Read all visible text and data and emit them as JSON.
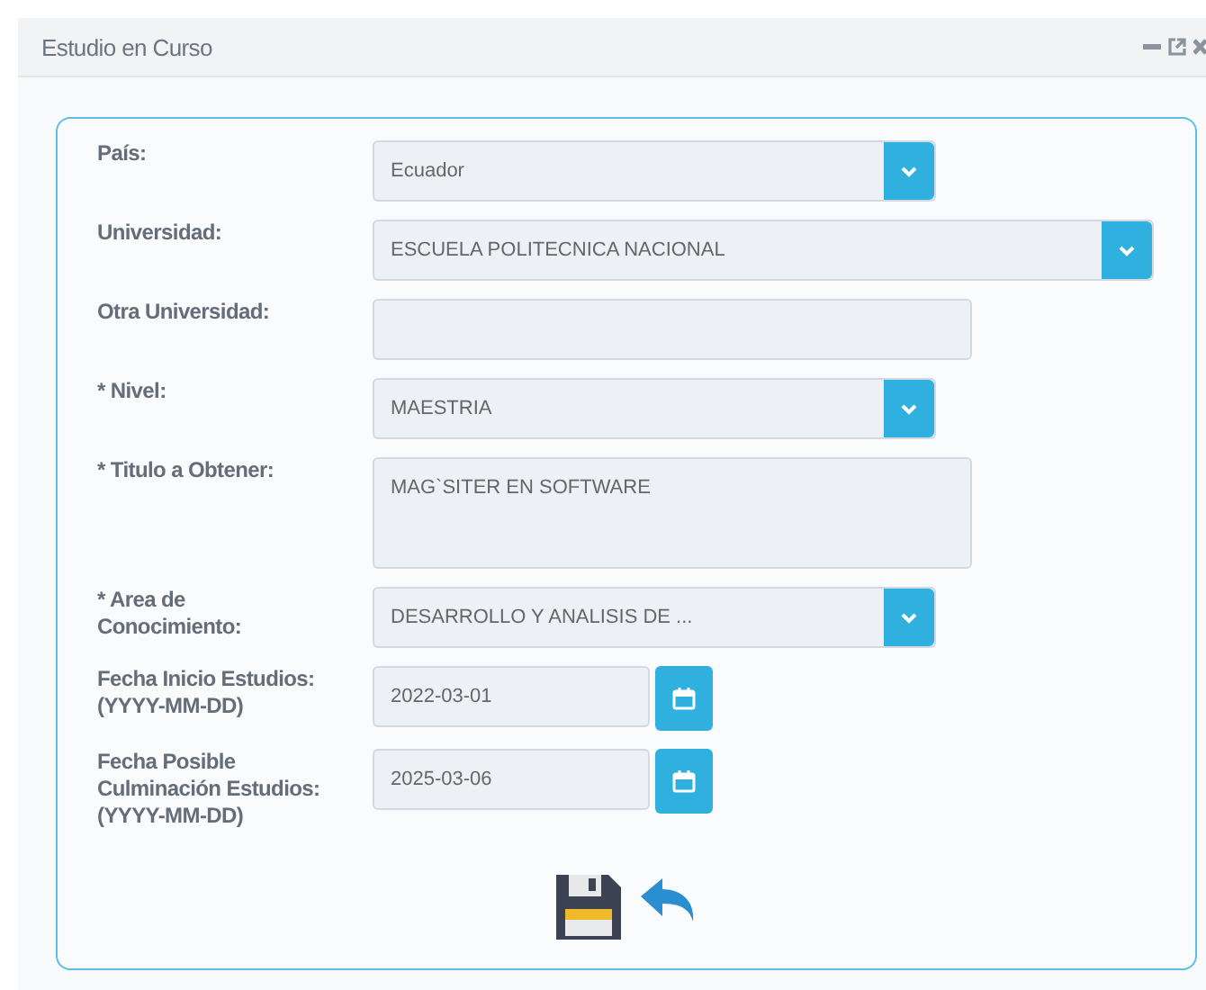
{
  "window": {
    "title": "Estudio en Curso"
  },
  "fields": [
    {
      "label": [
        "País:"
      ],
      "kind": "select",
      "value": "Ecuador"
    },
    {
      "label": [
        "Universidad:"
      ],
      "kind": "wide-select",
      "value": "ESCUELA POLITECNICA NACIONAL"
    },
    {
      "label": [
        "Otra Universidad:"
      ],
      "kind": "text"
    },
    {
      "label": [
        "* Nivel:"
      ],
      "kind": "select",
      "value": "MAESTRIA"
    },
    {
      "label": [
        "* Titulo a Obtener:"
      ],
      "kind": "textarea",
      "value": "MAG`SITER EN SOFTWARE"
    },
    {
      "label": [
        "* Area de",
        "Conocimiento:"
      ],
      "kind": "select",
      "value": "DESARROLLO Y ANALISIS DE ..."
    },
    {
      "label": [
        "Fecha Inicio Estudios:",
        "(YYYY-MM-DD)"
      ],
      "kind": "date",
      "value": "2022-03-01"
    },
    {
      "label": [
        "Fecha Posible",
        "Culminación Estudios:",
        "(YYYY-MM-DD)"
      ],
      "kind": "date",
      "value": "2025-03-06"
    }
  ]
}
